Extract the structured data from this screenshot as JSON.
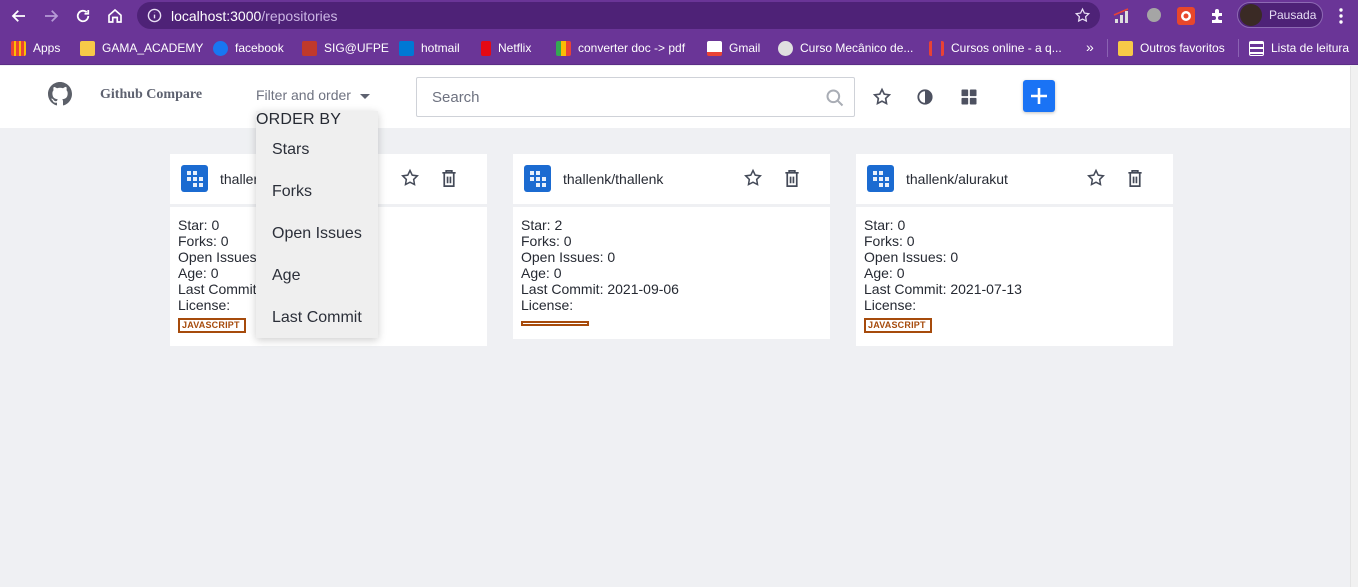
{
  "browser": {
    "url_host": "localhost:3000",
    "url_path": "/repositories",
    "profile_label": "Pausada",
    "bookmarks": [
      {
        "label": "Apps",
        "color": "#e94235"
      },
      {
        "label": "GAMA_ACADEMY",
        "color": "#f7c948"
      },
      {
        "label": "facebook",
        "color": "#1877f2"
      },
      {
        "label": "SIG@UFPE",
        "color": "#c0392b"
      },
      {
        "label": "hotmail",
        "color": "#0078d4"
      },
      {
        "label": "Netflix",
        "color": "#e50914"
      },
      {
        "label": "converter doc -> pdf",
        "color": "#34a853"
      },
      {
        "label": "Gmail",
        "color": "#ea4335"
      },
      {
        "label": "Curso Mecânico de...",
        "color": "#9e9e9e"
      },
      {
        "label": "Cursos online - a q...",
        "color": "#e94235"
      }
    ],
    "overflow_label": "»",
    "other_bookmarks": "Outros favoritos",
    "reading_list": "Lista de leitura"
  },
  "header": {
    "title": "Github Compare",
    "filter_label": "Filter and order",
    "search_placeholder": "Search"
  },
  "dropdown": {
    "title": "ORDER BY",
    "items": [
      "Stars",
      "Forks",
      "Open Issues",
      "Age",
      "Last Commit"
    ]
  },
  "cards": [
    {
      "name": "thallenk/",
      "stars": "Star: 0",
      "forks": "Forks: 0",
      "issues": "Open Issues: 0",
      "age": "Age: 0",
      "last_commit": "Last Commit:",
      "license": "License:",
      "language": "JAVASCRIPT"
    },
    {
      "name": "thallenk/thallenk",
      "stars": "Star: 2",
      "forks": "Forks: 0",
      "issues": "Open Issues: 0",
      "age": "Age: 0",
      "last_commit": "Last Commit: 2021-09-06",
      "license": "License:",
      "language": ""
    },
    {
      "name": "thallenk/alurakut",
      "stars": "Star: 0",
      "forks": "Forks: 0",
      "issues": "Open Issues: 0",
      "age": "Age: 0",
      "last_commit": "Last Commit: 2021-07-13",
      "license": "License:",
      "language": "JAVASCRIPT"
    }
  ],
  "colors": {
    "brand_purple": "#6a3597",
    "accent_blue": "#1a73f5",
    "language_tag": "#a64b0c",
    "background": "#eff0f3"
  }
}
